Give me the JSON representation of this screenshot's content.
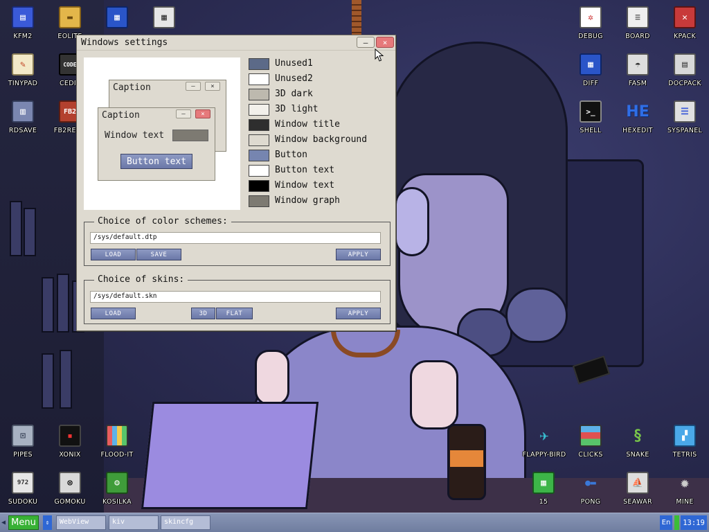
{
  "desktop": {
    "icons_left": [
      {
        "label": "KFM2",
        "icon": "floppy-icon",
        "color": "#3a5ad8"
      },
      {
        "label": "EOLITE",
        "icon": "folder-icon",
        "color": "#e3b64a"
      },
      {
        "label": "TINYPAD",
        "icon": "notepad-icon",
        "color": "#f3e9c8"
      },
      {
        "label": "CEDIT",
        "icon": "code-editor-icon",
        "color": "#333333"
      },
      {
        "label": "RDSAVE",
        "icon": "disk-save-icon",
        "color": "#7a86b0"
      },
      {
        "label": "FB2READ",
        "icon": "book-reader-icon",
        "color": "#b3412e"
      },
      {
        "label": "PIPES",
        "icon": "pipes-icon",
        "color": "#a8b2c2"
      },
      {
        "label": "XONIX",
        "icon": "xonix-icon",
        "color": "#111111"
      },
      {
        "label": "FLOOD-IT",
        "icon": "flood-it-icon",
        "color": "#e85d5d"
      },
      {
        "label": "SUDOKU",
        "icon": "sudoku-icon",
        "color": "#e6e6e6"
      },
      {
        "label": "GOMOKU",
        "icon": "gomoku-icon",
        "color": "#d9d9d9"
      },
      {
        "label": "KOSILKA",
        "icon": "lawnmower-icon",
        "color": "#3f9c3a"
      }
    ],
    "icons_top_middle": [
      {
        "label": "",
        "icon": "palette-window-icon",
        "color": "#2a55c8"
      },
      {
        "label": "",
        "icon": "calculator-icon",
        "color": "#e6e6e6"
      }
    ],
    "icons_right": [
      {
        "label": "DEBUG",
        "icon": "debug-bug-icon",
        "color": "#ffffff"
      },
      {
        "label": "BOARD",
        "icon": "board-icon",
        "color": "#eeeeee"
      },
      {
        "label": "KPACK",
        "icon": "hammer-icon",
        "color": "#c83a3a"
      },
      {
        "label": "DIFF",
        "icon": "diff-icon",
        "color": "#2a55c8"
      },
      {
        "label": "FASM",
        "icon": "fasm-icon",
        "color": "#dddddd"
      },
      {
        "label": "DOCPACK",
        "icon": "docpack-icon",
        "color": "#d8d8d8"
      },
      {
        "label": "SHELL",
        "icon": "shell-terminal-icon",
        "color": "#111111"
      },
      {
        "label": "HEXEDIT",
        "icon": "hexedit-icon",
        "color": "#2f6ee6"
      },
      {
        "label": "SYSPANEL",
        "icon": "syspanel-sliders-icon",
        "color": "#e0e0e0"
      },
      {
        "label": "FLAPPY-BIRD",
        "icon": "flappy-bird-icon",
        "color": "#38c2d4"
      },
      {
        "label": "CLICKS",
        "icon": "clicks-blocks-icon",
        "color": "#e05050"
      },
      {
        "label": "SNAKE",
        "icon": "snake-icon",
        "color": "#78c44a"
      },
      {
        "label": "TETRIS",
        "icon": "tetris-icon",
        "color": "#4aa8e8"
      },
      {
        "label": "15",
        "icon": "fifteen-puzzle-icon",
        "color": "#3db548"
      },
      {
        "label": "PONG",
        "icon": "pong-icon",
        "color": "#3a78d8"
      },
      {
        "label": "SEAWAR",
        "icon": "seawar-ship-icon",
        "color": "#dddddd"
      },
      {
        "label": "MINE",
        "icon": "mine-icon",
        "color": "#cccccc"
      }
    ]
  },
  "window": {
    "title": "Windows settings",
    "min_label": "–",
    "close_label": "×",
    "preview": {
      "back_caption": "Caption",
      "front_caption": "Caption",
      "window_text": "Window text",
      "button_text": "Button text",
      "min_label": "–",
      "close_label": "×"
    },
    "colors": [
      {
        "label": "Unused1",
        "color": "#5c6a88"
      },
      {
        "label": "Unused2",
        "color": "#ffffff"
      },
      {
        "label": "3D dark",
        "color": "#bdb9ae"
      },
      {
        "label": "3D light",
        "color": "#f2f0eb"
      },
      {
        "label": "Window title",
        "color": "#2e2e2e"
      },
      {
        "label": "Window background",
        "color": "#dedad0"
      },
      {
        "label": "Button",
        "color": "#7685b0"
      },
      {
        "label": "Button text",
        "color": "#ffffff"
      },
      {
        "label": "Window text",
        "color": "#000000"
      },
      {
        "label": "Window graph",
        "color": "#7d7a72"
      }
    ],
    "color_schemes": {
      "legend": "Choice of color schemes:",
      "path": "/sys/default.dtp",
      "load": "LOAD",
      "save": "SAVE",
      "apply": "APPLY"
    },
    "skins": {
      "legend": "Choice of skins:",
      "path": "/sys/default.skn",
      "load": "LOAD",
      "btn_3d": "3D",
      "flat": "FLAT",
      "apply": "APPLY"
    }
  },
  "taskbar": {
    "menu_label": "Menu",
    "tasks": [
      "WebView",
      "kiv",
      "skincfg"
    ],
    "lang": "En",
    "clock": "13:19"
  }
}
